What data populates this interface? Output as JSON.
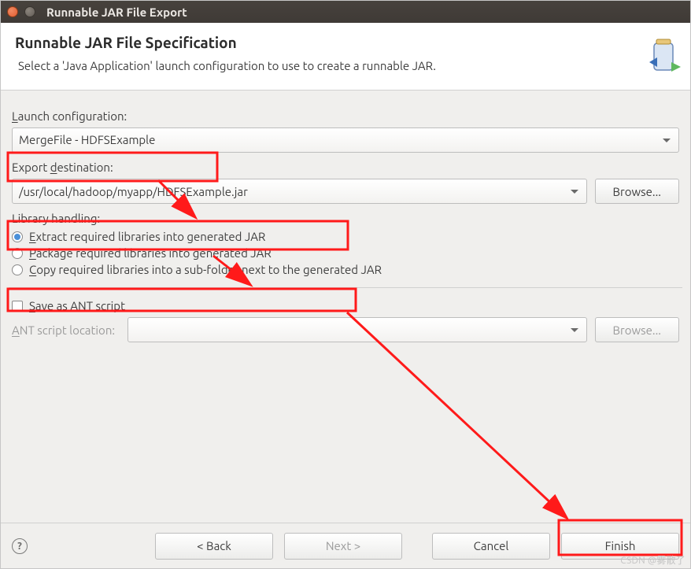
{
  "window": {
    "title": "Runnable JAR File Export"
  },
  "header": {
    "title": "Runnable JAR File Specification",
    "description": "Select a 'Java Application' launch configuration to use to create a runnable JAR."
  },
  "fields": {
    "launch_config": {
      "u": "L",
      "r": "aunch configuration:",
      "value": "MergeFile - HDFSExample"
    },
    "export_dest": {
      "p": "Export ",
      "u": "d",
      "r": "estination:",
      "value": "/usr/local/hadoop/myapp/HDFSExample.jar",
      "browse": "Browse..."
    },
    "lib": {
      "label": "Library handling:",
      "opt1": {
        "u": "E",
        "r": "xtract required libraries into generated JAR"
      },
      "opt2": {
        "u": "P",
        "r": "ackage required libraries into generated JAR"
      },
      "opt3": {
        "u": "C",
        "r": "opy required libraries into a sub-folder next to the generated JAR"
      },
      "selected": 0
    },
    "ant": {
      "save": {
        "u": "S",
        "r": "ave as ANT script",
        "checked": false
      },
      "loc": {
        "u": "A",
        "r": "NT script location:"
      },
      "browse": "Browse..."
    }
  },
  "buttons": {
    "back": "< Back",
    "next": "Next >",
    "cancel": "Cancel",
    "finish": "Finish"
  },
  "annotations": {
    "highlight_color": "#ff1a1a",
    "highlighted": [
      "launch-config-combo",
      "export-dest-combo",
      "radio-extract",
      "finish-button"
    ]
  },
  "watermark": "CSDN @雾散了"
}
